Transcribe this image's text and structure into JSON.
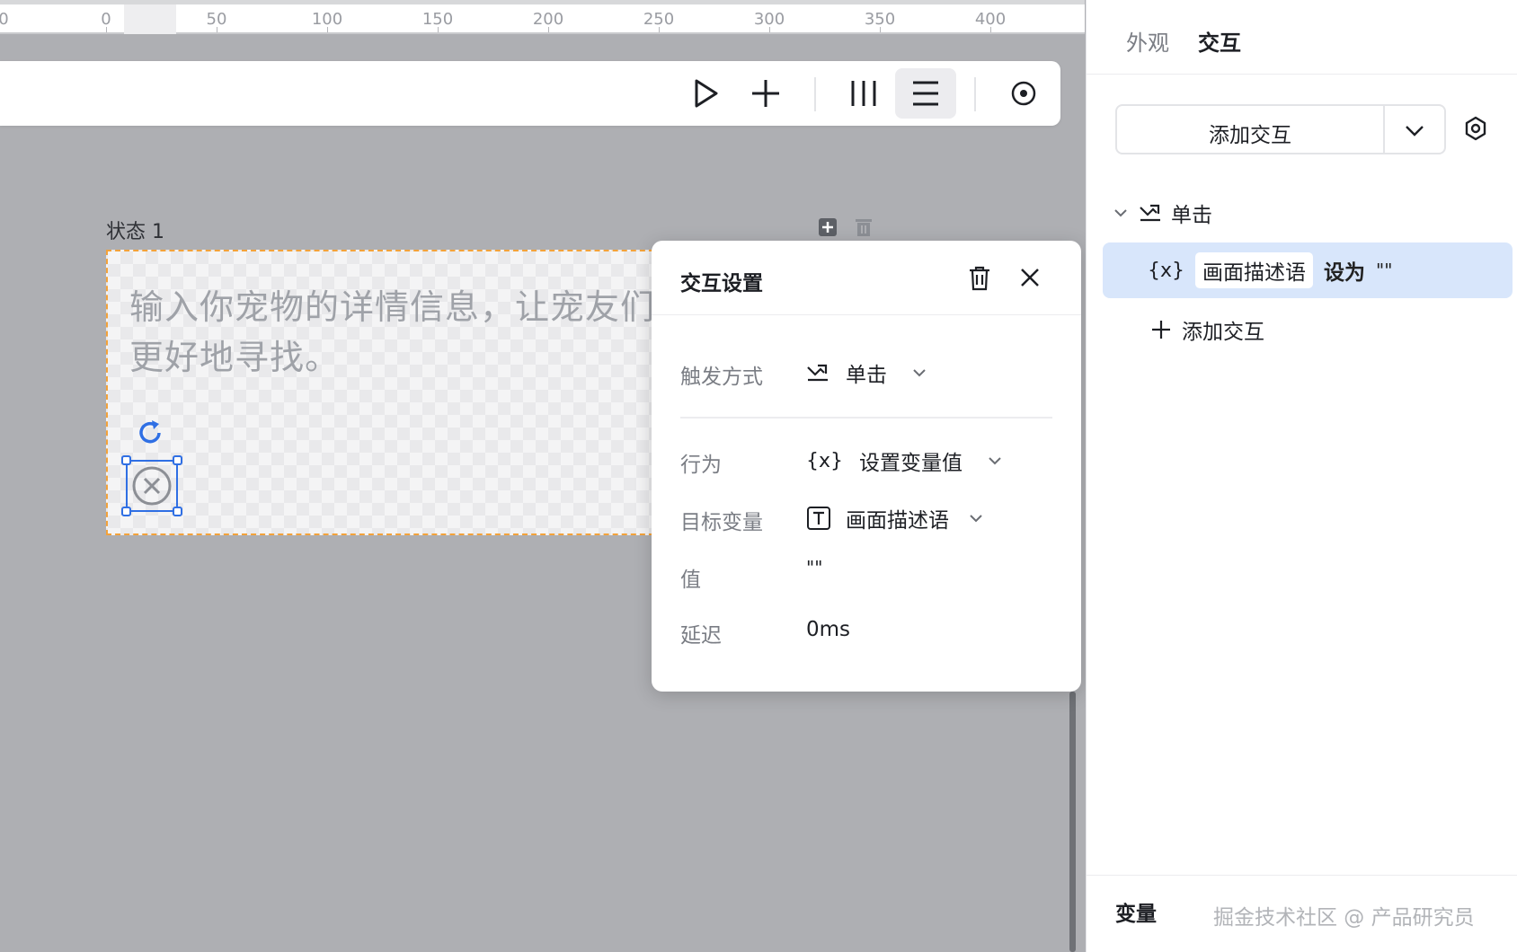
{
  "ruler": {
    "labels": [
      "0",
      "0",
      "50",
      "100",
      "150",
      "200",
      "250",
      "300",
      "350",
      "400"
    ]
  },
  "toolbar": {
    "buttons": [
      "play-icon",
      "plus-icon",
      "columns-icon",
      "rows-icon",
      "target-icon"
    ]
  },
  "canvas": {
    "state_label": "状态 1",
    "placeholder_text": "输入你宠物的详情信息，让宠友们更好地寻找。",
    "placeholder_line2": "寻找。"
  },
  "popup": {
    "title": "交互设置",
    "rows": {
      "trigger_label": "触发方式",
      "trigger_value": "单击",
      "action_label": "行为",
      "action_value": "设置变量值",
      "target_label": "目标变量",
      "target_value": "画面描述语",
      "value_label": "值",
      "value_value": "\"\"",
      "delay_label": "延迟",
      "delay_value": "0ms"
    }
  },
  "panel": {
    "tabs": [
      "外观",
      "交互"
    ],
    "active_tab": "交互",
    "add_button_label": "添加交互",
    "trigger_label": "单击",
    "action_chip": "画面描述语",
    "action_verb": "设为",
    "action_value": "\"\"",
    "add_interaction_label": "添加交互",
    "variables_label": "变量",
    "watermark": "掘金技术社区 @ 产品研究员"
  },
  "colors": {
    "accent": "#2f6fe4",
    "selection_row": "#d8e6fb",
    "artboard_border": "#f3a23a",
    "canvas_bg": "#aeafb3"
  }
}
